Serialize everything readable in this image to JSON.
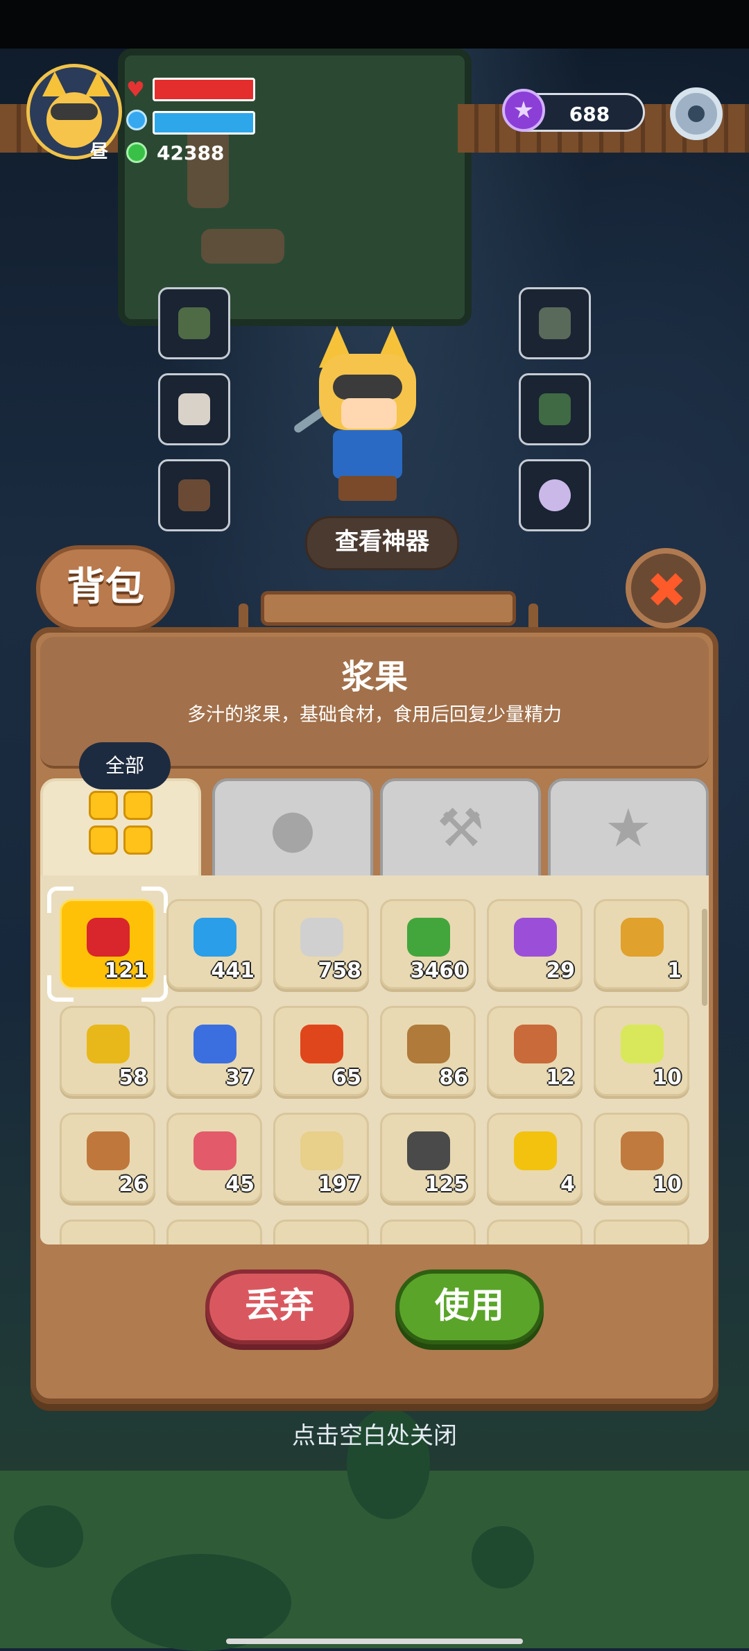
{
  "hud": {
    "day_tag": "昼",
    "gem_count": "42388",
    "currency_value": "688",
    "currency_icon": "purple-star-coin",
    "settings_icon": "gear-icon"
  },
  "equipment": {
    "left_slots": [
      "goggles-cat-mask",
      "white-glove",
      "brown-backpack"
    ],
    "right_slots": [
      "green-armor",
      "green-boots",
      "pearl-necklace"
    ],
    "view_artifact_label": "查看神器"
  },
  "backpack": {
    "title": "背包",
    "selected_item": {
      "name": "浆果",
      "description": "多汁的浆果，基础食材，食用后回复少量精力"
    },
    "tabs": [
      {
        "label": "全部",
        "icon": "grid-icon",
        "active": true
      },
      {
        "label": "",
        "icon": "apple-icon",
        "active": false
      },
      {
        "label": "",
        "icon": "tools-icon",
        "active": false
      },
      {
        "label": "",
        "icon": "star-icon",
        "active": false
      }
    ],
    "items": [
      {
        "name": "strawberry",
        "count": "121",
        "color": "#d8262c",
        "selected": true
      },
      {
        "name": "blue-slime",
        "count": "441",
        "color": "#2a9ee8"
      },
      {
        "name": "stone",
        "count": "758",
        "color": "#d0d0d0"
      },
      {
        "name": "herb-bundle",
        "count": "3460",
        "color": "#43a63c"
      },
      {
        "name": "purple-gem",
        "count": "29",
        "color": "#9b4fd8"
      },
      {
        "name": "wheat",
        "count": "1",
        "color": "#e0a12d"
      },
      {
        "name": "gold-bar",
        "count": "58",
        "color": "#e8b81a"
      },
      {
        "name": "butterfly",
        "count": "37",
        "color": "#3b6fe0"
      },
      {
        "name": "orange-fruit",
        "count": "65",
        "color": "#e0461c"
      },
      {
        "name": "wood-plank",
        "count": "86",
        "color": "#b07a3a"
      },
      {
        "name": "wood-log",
        "count": "12",
        "color": "#c96a3a"
      },
      {
        "name": "firefly",
        "count": "10",
        "color": "#d9e85a"
      },
      {
        "name": "fish",
        "count": "26",
        "color": "#c0773c"
      },
      {
        "name": "raw-meat",
        "count": "45",
        "color": "#e35a6a"
      },
      {
        "name": "flour",
        "count": "197",
        "color": "#e8cf8a"
      },
      {
        "name": "coal",
        "count": "125",
        "color": "#4a4a4a"
      },
      {
        "name": "gold-nugget",
        "count": "4",
        "color": "#f2c20f"
      },
      {
        "name": "ladder",
        "count": "10",
        "color": "#c17a3e"
      }
    ],
    "discard_label": "丢弃",
    "use_label": "使用",
    "close_hint": "点击空白处关闭"
  }
}
